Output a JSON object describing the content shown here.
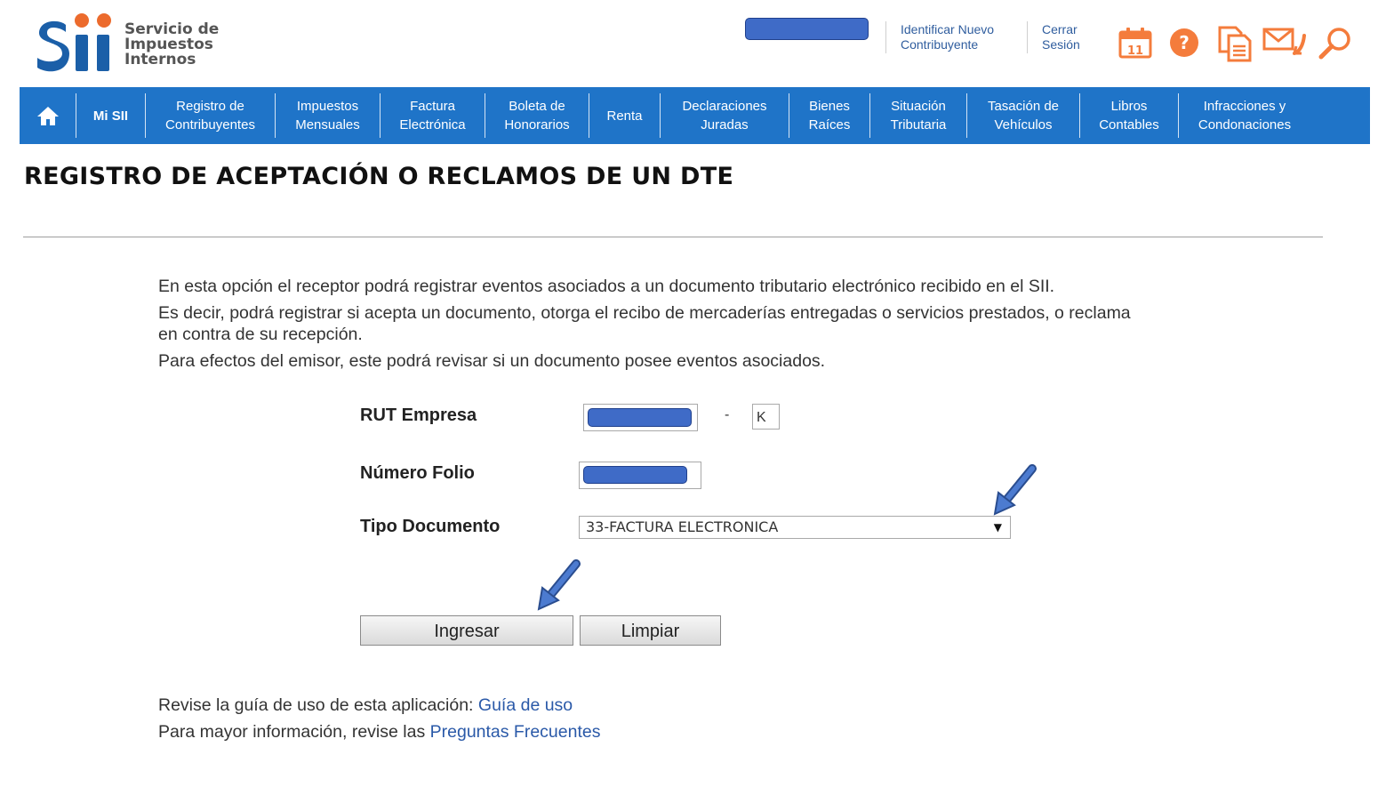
{
  "header": {
    "logo": {
      "line1": "Servicio de",
      "line2": "Impuestos",
      "line3": "Internos"
    },
    "links": [
      {
        "line1": "Identificar Nuevo",
        "line2": "Contribuyente"
      },
      {
        "line1": "Cerrar",
        "line2": "Sesión"
      }
    ],
    "calendar_day": "11",
    "icons": [
      "calendar-icon",
      "help-icon",
      "documents-icon",
      "mail-icon",
      "search-icon"
    ],
    "accent_color": "#f47c3c"
  },
  "nav": {
    "color": "#1f74c8",
    "items": [
      {
        "line1": "",
        "line2": ""
      },
      {
        "line1": "Mi SII",
        "line2": ""
      },
      {
        "line1": "Registro de",
        "line2": "Contribuyentes"
      },
      {
        "line1": "Impuestos",
        "line2": "Mensuales"
      },
      {
        "line1": "Factura",
        "line2": "Electrónica"
      },
      {
        "line1": "Boleta de",
        "line2": "Honorarios"
      },
      {
        "line1": "Renta",
        "line2": ""
      },
      {
        "line1": "Declaraciones",
        "line2": "Juradas"
      },
      {
        "line1": "Bienes",
        "line2": "Raíces"
      },
      {
        "line1": "Situación",
        "line2": "Tributaria"
      },
      {
        "line1": "Tasación de",
        "line2": "Vehículos"
      },
      {
        "line1": "Libros",
        "line2": "Contables"
      },
      {
        "line1": "Infracciones y",
        "line2": "Condonaciones"
      }
    ]
  },
  "page": {
    "title": "REGISTRO DE ACEPTACIÓN O RECLAMOS DE UN DTE",
    "intro": [
      "En esta opción el receptor podrá registrar eventos asociados a un documento tributario electrónico recibido en el SII.",
      "Es decir, podrá registrar si acepta un documento, otorga el recibo de mercaderías entregadas o servicios prestados, o reclama en contra de su recepción.",
      "Para efectos del emisor, este podrá revisar si un documento posee eventos asociados."
    ]
  },
  "form": {
    "rut_label": "RUT Empresa",
    "rut_separator": "-",
    "rut_dv": "K",
    "folio_label": "Número Folio",
    "tipo_label": "Tipo Documento",
    "tipo_value": "33-FACTURA ELECTRONICA",
    "submit_label": "Ingresar",
    "clear_label": "Limpiar"
  },
  "footer": {
    "guide_text": "Revise la guía de uso de esta aplicación: ",
    "guide_link": "Guía de uso",
    "faq_text": "Para mayor información, revise las ",
    "faq_link": "Preguntas Frecuentes"
  }
}
